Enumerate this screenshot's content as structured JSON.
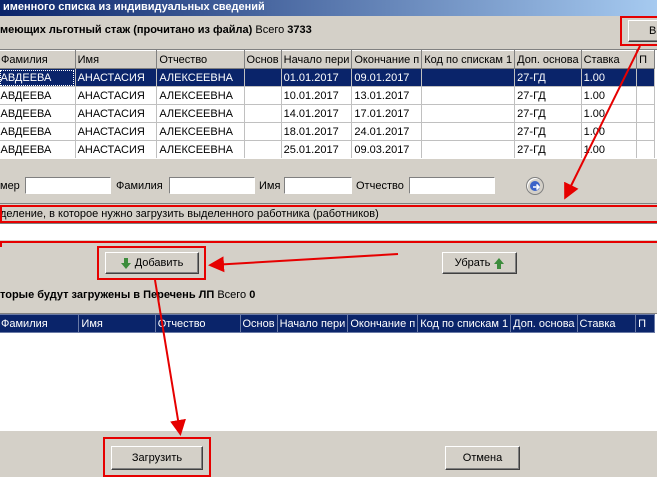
{
  "window": {
    "title": "именного списка из индивидуальных сведений"
  },
  "top_section": {
    "caption": "меющих льготный стаж (прочитано из файла)",
    "total_label": "Всего",
    "total_value": "3733",
    "corner_button_label": "В"
  },
  "columns": [
    "Фамилия",
    "Имя",
    "Отчество",
    "Основ",
    "Начало пери",
    "Окончание п",
    "Код по спискам 1",
    "Доп. основа",
    "Ставка",
    "П"
  ],
  "top_rows": [
    {
      "fam": "АВДЕЕВА",
      "name": "АНАСТАСИЯ",
      "otch": "АЛЕКСЕЕВНА",
      "osn": "",
      "start": "01.01.2017",
      "end": "09.01.2017",
      "code": "",
      "dop": "27-ГД",
      "rate": "1.00",
      "p": ""
    },
    {
      "fam": "АВДЕЕВА",
      "name": "АНАСТАСИЯ",
      "otch": "АЛЕКСЕЕВНА",
      "osn": "",
      "start": "10.01.2017",
      "end": "13.01.2017",
      "code": "",
      "dop": "27-ГД",
      "rate": "1.00",
      "p": ""
    },
    {
      "fam": "АВДЕЕВА",
      "name": "АНАСТАСИЯ",
      "otch": "АЛЕКСЕЕВНА",
      "osn": "",
      "start": "14.01.2017",
      "end": "17.01.2017",
      "code": "",
      "dop": "27-ГД",
      "rate": "1.00",
      "p": ""
    },
    {
      "fam": "АВДЕЕВА",
      "name": "АНАСТАСИЯ",
      "otch": "АЛЕКСЕЕВНА",
      "osn": "",
      "start": "18.01.2017",
      "end": "24.01.2017",
      "code": "",
      "dop": "27-ГД",
      "rate": "1.00",
      "p": ""
    },
    {
      "fam": "АВДЕЕВА",
      "name": "АНАСТАСИЯ",
      "otch": "АЛЕКСЕЕВНА",
      "osn": "",
      "start": "25.01.2017",
      "end": "09.03.2017",
      "code": "",
      "dop": "27-ГД",
      "rate": "1.00",
      "p": ""
    }
  ],
  "selected_row_index": 0,
  "filter": {
    "number_label": "мер",
    "surname_label": "Фамилия",
    "name_label": "Имя",
    "patronymic_label": "Отчество",
    "number_value": "",
    "surname_value": "",
    "name_value": "",
    "patronymic_value": ""
  },
  "department": {
    "hint": "деление, в которое нужно загрузить выделенного работника (работников)",
    "value": ""
  },
  "buttons": {
    "add_label": "Добавить",
    "remove_label": "Убрать",
    "load_label": "Загрузить",
    "cancel_label": "Отмена"
  },
  "bottom_section": {
    "caption": "торые будут загружены в Перечень ЛП",
    "total_label": "Всего",
    "total_value": "0"
  },
  "colors": {
    "highlight": "#e60000",
    "selection": "#0a246a",
    "add_arrow": "#3c8c3c",
    "remove_arrow": "#3c8c3c"
  },
  "icons": {
    "add": "arrow-down-icon",
    "remove": "arrow-up-icon",
    "go": "arrow-right-circle-icon"
  }
}
